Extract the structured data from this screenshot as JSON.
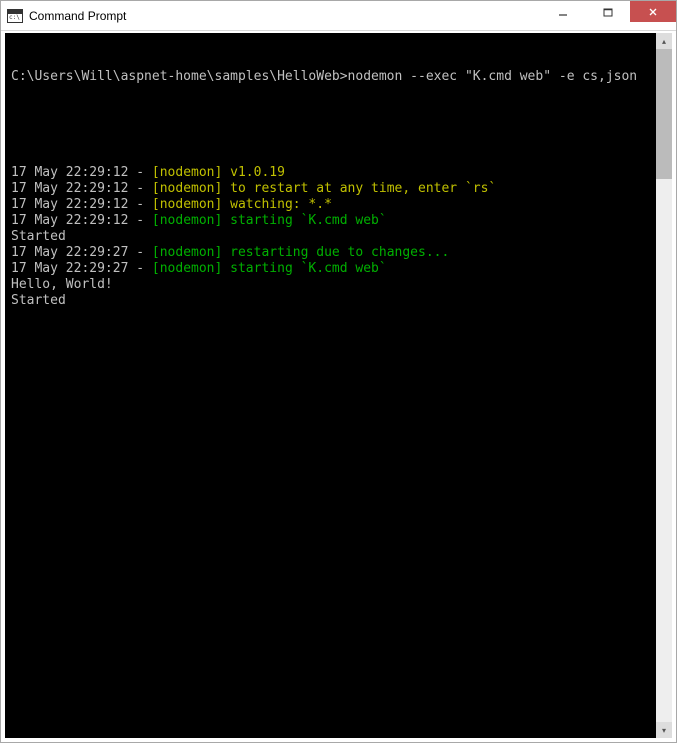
{
  "window": {
    "title": "Command Prompt"
  },
  "console": {
    "prompt_line": "C:\\Users\\Will\\aspnet-home\\samples\\HelloWeb>nodemon --exec \"K.cmd web\" -e cs,json",
    "lines": [
      {
        "ts": "17 May 22:29:12",
        "sep": " - ",
        "color": "yellow",
        "text": "[nodemon] v1.0.19"
      },
      {
        "ts": "17 May 22:29:12",
        "sep": " - ",
        "color": "yellow",
        "text": "[nodemon] to restart at any time, enter `rs`"
      },
      {
        "ts": "17 May 22:29:12",
        "sep": " - ",
        "color": "yellow",
        "text": "[nodemon] watching: *.*"
      },
      {
        "ts": "17 May 22:29:12",
        "sep": " - ",
        "color": "green",
        "text": "[nodemon] starting `K.cmd web`"
      },
      {
        "plain": "Started"
      },
      {
        "ts": "17 May 22:29:27",
        "sep": " - ",
        "color": "green",
        "text": "[nodemon] restarting due to changes..."
      },
      {
        "ts": "17 May 22:29:27",
        "sep": " - ",
        "color": "green",
        "text": "[nodemon] starting `K.cmd web`"
      },
      {
        "plain": "Hello, World!"
      },
      {
        "plain": "Started"
      }
    ]
  }
}
